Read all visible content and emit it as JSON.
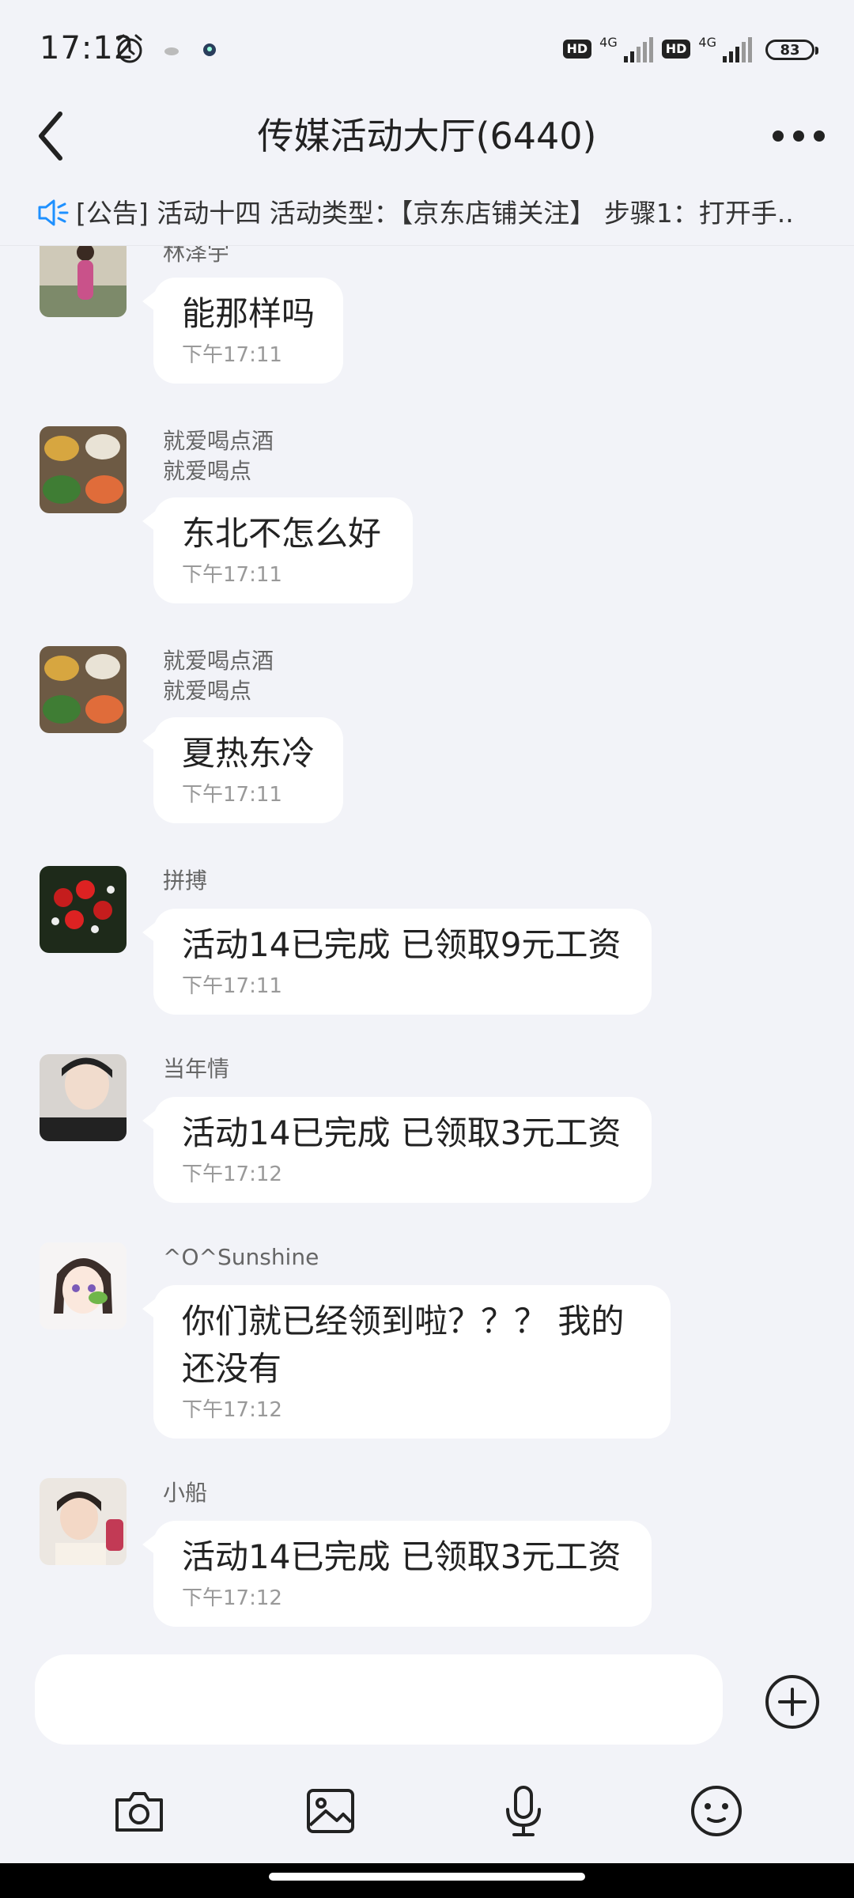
{
  "status_bar": {
    "time": "17:12",
    "network1": "4G",
    "network2": "4G",
    "hd_label": "HD",
    "battery": "83"
  },
  "header": {
    "title": "传媒活动大厅(6440)"
  },
  "notice": {
    "text": "[公告] 活动十四 活动类型：【京东店铺关注】 步骤1：打开手.."
  },
  "messages": [
    {
      "sender": "林泽宇",
      "text": "能那样吗",
      "time": "下午17:11"
    },
    {
      "sender": "就爱喝点酒\n就爱喝点",
      "text": "东北不怎么好",
      "time": "下午17:11"
    },
    {
      "sender": "就爱喝点酒\n就爱喝点",
      "text": "夏热东冷",
      "time": "下午17:11"
    },
    {
      "sender": "拼搏",
      "text": "活动14已完成 已领取9元工资",
      "time": "下午17:11"
    },
    {
      "sender": "当年情",
      "text": "活动14已完成 已领取3元工资",
      "time": "下午17:12"
    },
    {
      "sender": "^O^Sunshine",
      "text": "你们就已经领到啦？？？ 我的\n还没有",
      "time": "下午17:12"
    },
    {
      "sender": "小船",
      "text": "活动14已完成 已领取3元工资",
      "time": "下午17:12"
    }
  ],
  "input": {
    "placeholder": ""
  },
  "colors": {
    "background": "#f2f3f8",
    "bubble": "#ffffff",
    "accent": "#1e90ff"
  },
  "icons": [
    "back-icon",
    "more-icon",
    "speaker-icon",
    "plus-icon",
    "camera-icon",
    "image-icon",
    "microphone-icon",
    "emoji-icon",
    "alarm-icon"
  ]
}
